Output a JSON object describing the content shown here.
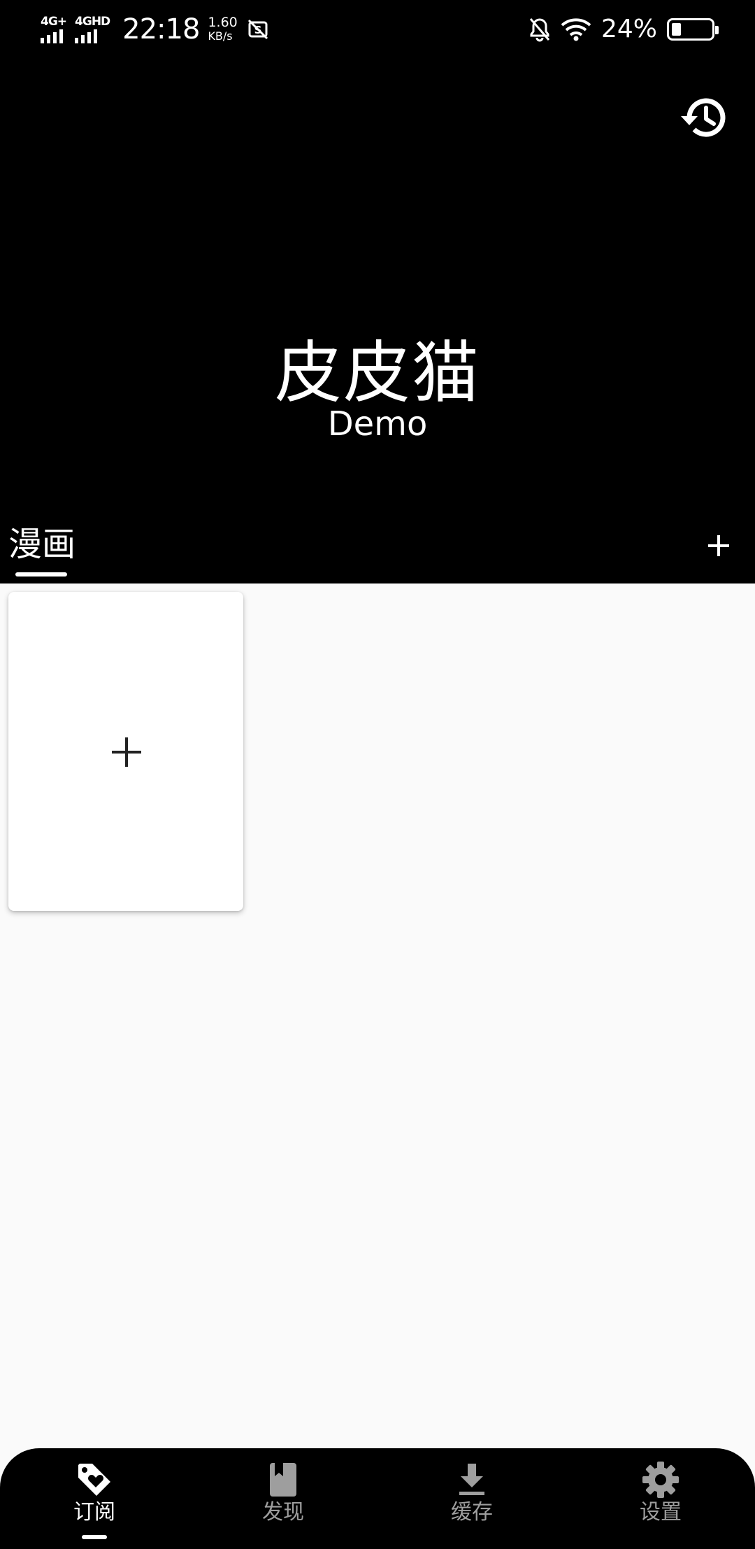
{
  "status_bar": {
    "sim1": "4G+",
    "sim2": "4GHD",
    "time": "22:18",
    "net_speed_value": "1.60",
    "net_speed_unit": "KB/s",
    "battery_percent": "24%",
    "battery_level": 0.24
  },
  "header": {
    "title": "皮皮猫",
    "subtitle": "Demo",
    "tab_label": "漫画"
  },
  "bottom_nav": {
    "items": [
      {
        "label": "订阅",
        "icon": "tag-heart-icon",
        "active": true
      },
      {
        "label": "发现",
        "icon": "book-bookmark-icon",
        "active": false
      },
      {
        "label": "缓存",
        "icon": "download-icon",
        "active": false
      },
      {
        "label": "设置",
        "icon": "gear-icon",
        "active": false
      }
    ]
  },
  "colors": {
    "header_bg": "#000000",
    "content_bg": "#fafafa",
    "card_bg": "#ffffff",
    "nav_active": "#ffffff",
    "nav_inactive": "#9e9e9e"
  }
}
